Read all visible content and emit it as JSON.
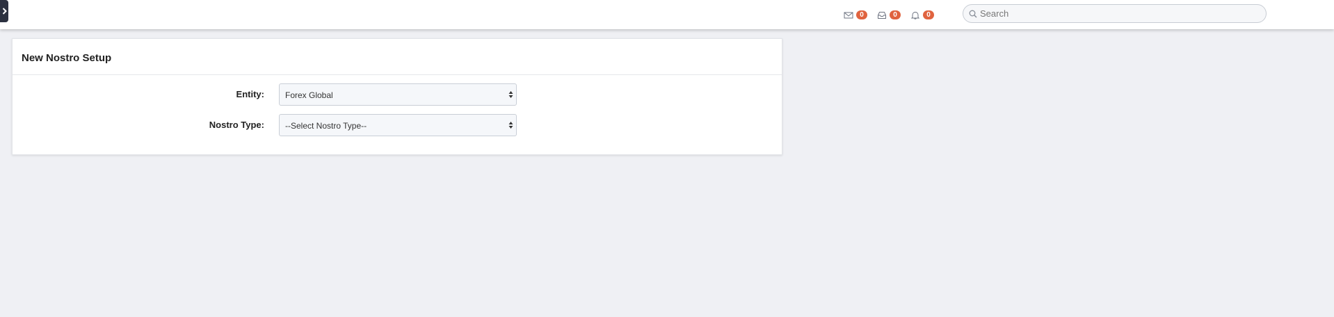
{
  "topbar": {
    "sidebar_toggle_icon": "chevron-right-icon",
    "notifications": [
      {
        "icon": "envelope-icon",
        "count": "0"
      },
      {
        "icon": "inbox-icon",
        "count": "0"
      },
      {
        "icon": "bell-icon",
        "count": "0"
      }
    ],
    "badge_color": "#e0633f",
    "search": {
      "placeholder": "Search",
      "value": ""
    }
  },
  "panel": {
    "title": "New Nostro Setup",
    "fields": [
      {
        "label": "Entity:",
        "value": "Forex Global"
      },
      {
        "label": "Nostro Type:",
        "value": "--Select Nostro Type--"
      }
    ]
  }
}
